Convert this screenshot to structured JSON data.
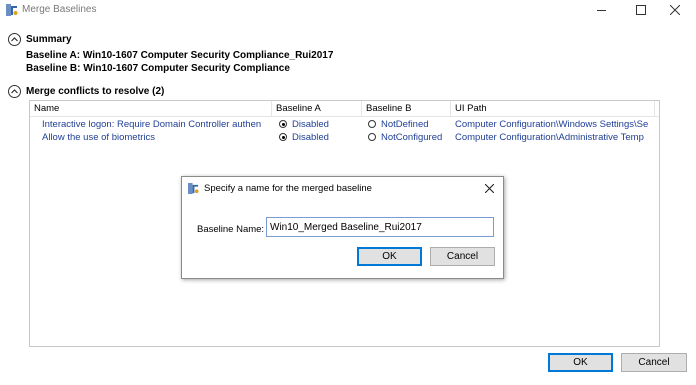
{
  "window": {
    "title": "Merge Baselines",
    "icon": "merge-baselines-app-icon"
  },
  "summary": {
    "heading": "Summary",
    "baseline_a": "Baseline A: Win10-1607 Computer Security Compliance_Rui2017",
    "baseline_b": "Baseline B: Win10-1607 Computer Security Compliance"
  },
  "conflicts": {
    "heading": "Merge conflicts to resolve (2)",
    "columns": [
      "Name",
      "Baseline A",
      "Baseline B",
      "UI Path"
    ],
    "rows": [
      {
        "name": "Interactive logon: Require Domain Controller authen",
        "baseline_a": "Disabled",
        "baseline_a_selected": true,
        "baseline_b": "NotDefined",
        "baseline_b_selected": false,
        "ui_path": "Computer Configuration\\Windows Settings\\Se"
      },
      {
        "name": "Allow the use of biometrics",
        "baseline_a": "Disabled",
        "baseline_a_selected": true,
        "baseline_b": "NotConfigured",
        "baseline_b_selected": false,
        "ui_path": "Computer Configuration\\Administrative Temp"
      }
    ]
  },
  "dialog": {
    "title": "Specify a name for the merged baseline",
    "label": "Baseline Name:",
    "value": "Win10_Merged Baseline_Rui2017",
    "ok": "OK",
    "cancel": "Cancel"
  },
  "footer": {
    "ok": "OK",
    "cancel": "Cancel"
  },
  "colors": {
    "link": "#1f3f95",
    "accent": "#0078d7"
  }
}
